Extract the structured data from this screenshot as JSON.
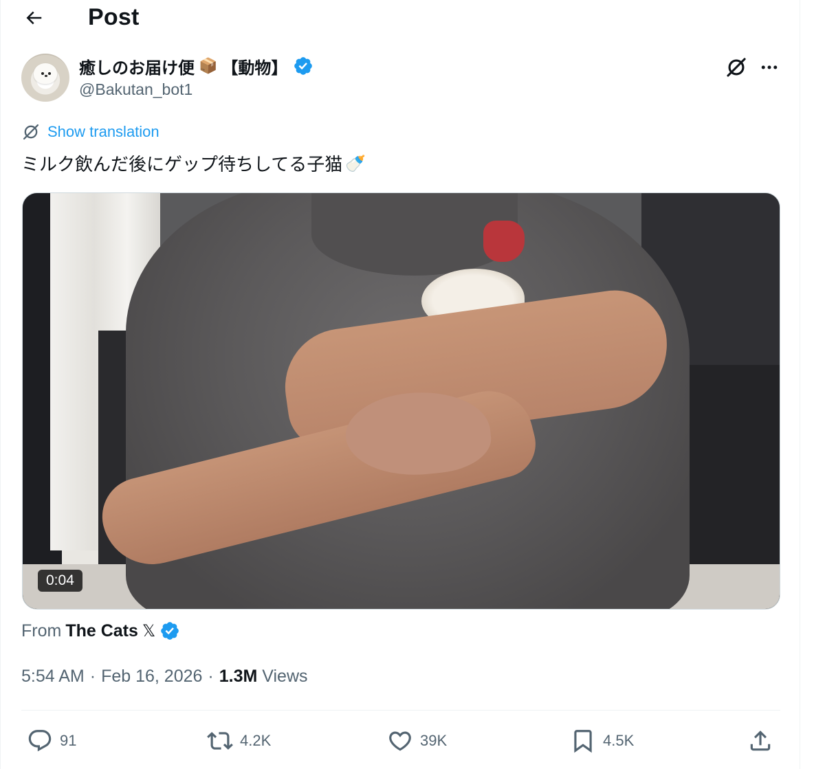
{
  "header": {
    "title": "Post",
    "back_icon": "arrow-left-icon"
  },
  "author": {
    "display_name": "癒しのお届け便",
    "name_emoji": "📦",
    "name_suffix": "【動物】",
    "handle": "@Bakutan_bot1",
    "verified_color": "#1d9bf0"
  },
  "tweet": {
    "show_translation": "Show translation",
    "text": "ミルク飲んだ後にゲップ待ちしてる子猫",
    "text_emoji": "🍼"
  },
  "video": {
    "duration": "0:04"
  },
  "source": {
    "from_label": "From",
    "from_name": "The Cats",
    "x_mark": "𝕏"
  },
  "meta": {
    "time": "5:54 AM",
    "sep1": "·",
    "date": "Feb 16, 2026",
    "sep2": "·",
    "views_count": "1.3M",
    "views_label": "Views"
  },
  "actions": {
    "replies": "91",
    "reposts": "4.2K",
    "likes": "39K",
    "bookmarks": "4.5K"
  },
  "colors": {
    "accent": "#1d9bf0",
    "muted": "#536471",
    "text": "#0f1419"
  }
}
